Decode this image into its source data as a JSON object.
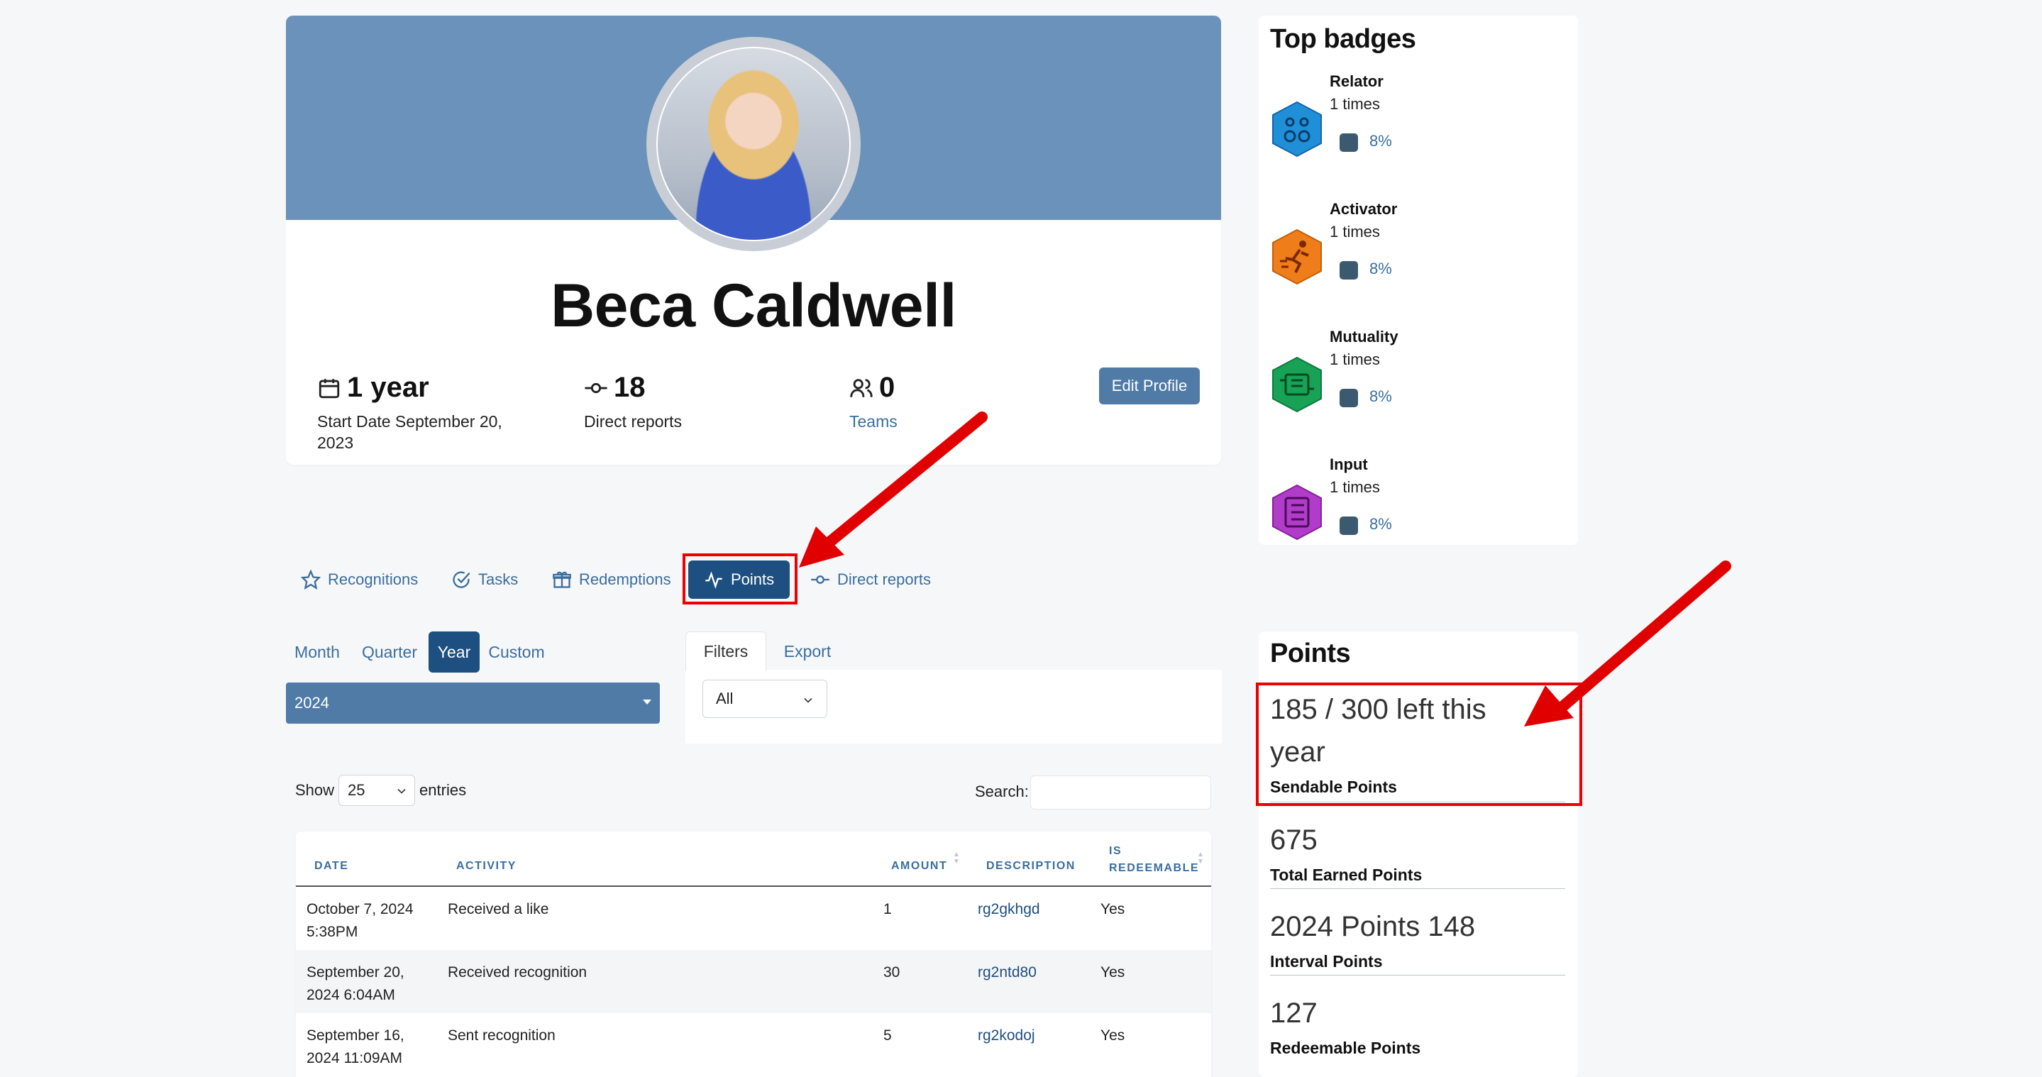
{
  "profile": {
    "name": "Beca Caldwell",
    "tenure_value": "1 year",
    "tenure_label": "Start Date September 20, 2023",
    "direct_reports_value": "18",
    "direct_reports_label": "Direct reports",
    "teams_value": "0",
    "teams_label": "Teams",
    "edit_button": "Edit Profile"
  },
  "tabs": [
    {
      "label": "Recognitions",
      "icon": "star-icon"
    },
    {
      "label": "Tasks",
      "icon": "check-circle-icon"
    },
    {
      "label": "Redemptions",
      "icon": "gift-icon"
    },
    {
      "label": "Points",
      "icon": "activity-icon",
      "active": true
    },
    {
      "label": "Direct reports",
      "icon": "commit-icon"
    }
  ],
  "period": {
    "options": [
      "Month",
      "Quarter",
      "Year",
      "Custom"
    ],
    "selected": "Year",
    "year_value": "2024"
  },
  "filters": {
    "tabs": [
      "Filters",
      "Export"
    ],
    "active_tab": "Filters",
    "select_value": "All"
  },
  "table_controls": {
    "show_label": "Show",
    "entries_value": "25",
    "entries_label": "entries",
    "search_label": "Search:"
  },
  "table": {
    "columns": [
      "Date",
      "Activity",
      "Amount",
      "Description",
      "Is redeemable"
    ],
    "rows": [
      {
        "date_line1": "October 7, 2024",
        "date_line2": "5:38PM",
        "activity": "Received a like",
        "amount": "1",
        "description": "rg2gkhgd",
        "redeemable": "Yes"
      },
      {
        "date_line1": "September 20,",
        "date_line2": "2024 6:04AM",
        "activity": "Received recognition",
        "amount": "30",
        "description": "rg2ntd80",
        "redeemable": "Yes"
      },
      {
        "date_line1": "September 16,",
        "date_line2": "2024 11:09AM",
        "activity": "Sent recognition",
        "amount": "5",
        "description": "rg2kodoj",
        "redeemable": "Yes"
      }
    ]
  },
  "badges": {
    "title": "Top badges",
    "items": [
      {
        "name": "Relator",
        "times": "1 times",
        "pct": "8%",
        "color": "#1f8fd8",
        "icon": "relator-badge-icon"
      },
      {
        "name": "Activator",
        "times": "1 times",
        "pct": "8%",
        "color": "#ef7d1a",
        "icon": "activator-badge-icon"
      },
      {
        "name": "Mutuality",
        "times": "1 times",
        "pct": "8%",
        "color": "#17a255",
        "icon": "mutuality-badge-icon"
      },
      {
        "name": "Input",
        "times": "1 times",
        "pct": "8%",
        "color": "#b13cc9",
        "icon": "input-badge-icon"
      }
    ]
  },
  "points": {
    "title": "Points",
    "sendable_line1": "185 / 300 left this",
    "sendable_line2": "year",
    "sendable_label": "Sendable Points",
    "total_value": "675",
    "total_label": "Total Earned Points",
    "interval_value": "2024 Points 148",
    "interval_label": "Interval Points",
    "redeemable_value": "127",
    "redeemable_label": "Redeemable Points"
  },
  "colors": {
    "cover": "#6a92ba",
    "primary": "#1d4f80",
    "accent": "#4f7ba6",
    "link": "#3a6e9e",
    "highlight": "#e00000"
  }
}
